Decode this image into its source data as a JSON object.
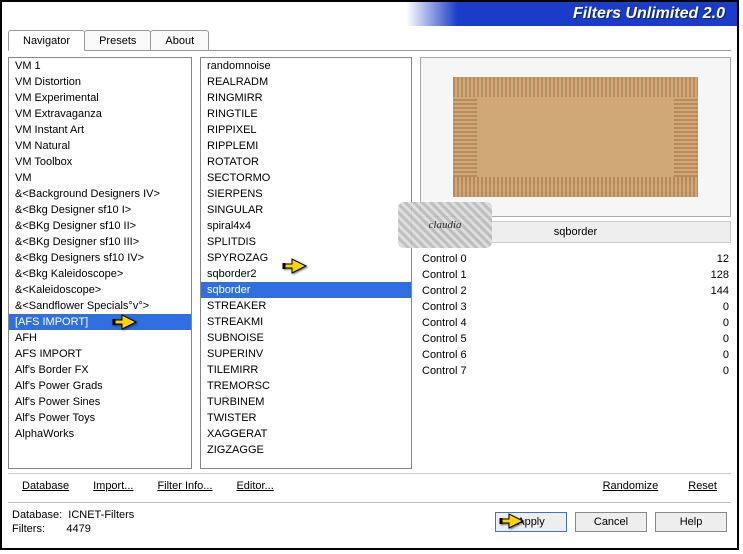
{
  "header": {
    "title": "Filters Unlimited 2.0"
  },
  "tabs": [
    "Navigator",
    "Presets",
    "About"
  ],
  "categories": {
    "selected": "[AFS IMPORT]",
    "items": [
      "VM 1",
      "VM Distortion",
      "VM Experimental",
      "VM Extravaganza",
      "VM Instant Art",
      "VM Natural",
      "VM Toolbox",
      "VM",
      "&<Background Designers IV>",
      "&<Bkg Designer sf10 I>",
      "&<BKg Designer sf10 II>",
      "&<BKg Designer sf10 III>",
      "&<Bkg Designers sf10 IV>",
      "&<Bkg Kaleidoscope>",
      "&<Kaleidoscope>",
      "&<Sandflower Specials°v°>",
      "[AFS IMPORT]",
      "AFH",
      "AFS IMPORT",
      "Alf's Border FX",
      "Alf's Power Grads",
      "Alf's Power Sines",
      "Alf's Power Toys",
      "AlphaWorks"
    ]
  },
  "filters": {
    "selected": "sqborder",
    "items": [
      "randomnoise",
      "REALRADM",
      "RINGMIRR",
      "RINGTILE",
      "RIPPIXEL",
      "RIPPLEMI",
      "ROTATOR",
      "SECTORMO",
      "SIERPENS",
      "SINGULAR",
      "spiral4x4",
      "SPLITDIS",
      "SPYROZAG",
      "sqborder2",
      "sqborder",
      "STREAKER",
      "STREAKMI",
      "SUBNOISE",
      "SUPERINV",
      "TILEMIRR",
      "TREMORSC",
      "TURBINEM",
      "TWISTER",
      "XAGGERAT",
      "ZIGZAGGE"
    ]
  },
  "right": {
    "selected_filter": "sqborder"
  },
  "controls": [
    {
      "label": "Control 0",
      "value": 12
    },
    {
      "label": "Control 1",
      "value": 128
    },
    {
      "label": "Control 2",
      "value": 144
    },
    {
      "label": "Control 3",
      "value": 0
    },
    {
      "label": "Control 4",
      "value": 0
    },
    {
      "label": "Control 5",
      "value": 0
    },
    {
      "label": "Control 6",
      "value": 0
    },
    {
      "label": "Control 7",
      "value": 0
    }
  ],
  "toolbar": {
    "left": [
      "Database",
      "Import...",
      "Filter Info...",
      "Editor..."
    ],
    "right": [
      "Randomize",
      "Reset"
    ]
  },
  "status": {
    "db_label": "Database:",
    "db_value": "ICNET-Filters",
    "filters_label": "Filters:",
    "filters_value": "4479"
  },
  "buttons": {
    "apply": "Apply",
    "cancel": "Cancel",
    "help": "Help"
  },
  "watermark": "claudia"
}
